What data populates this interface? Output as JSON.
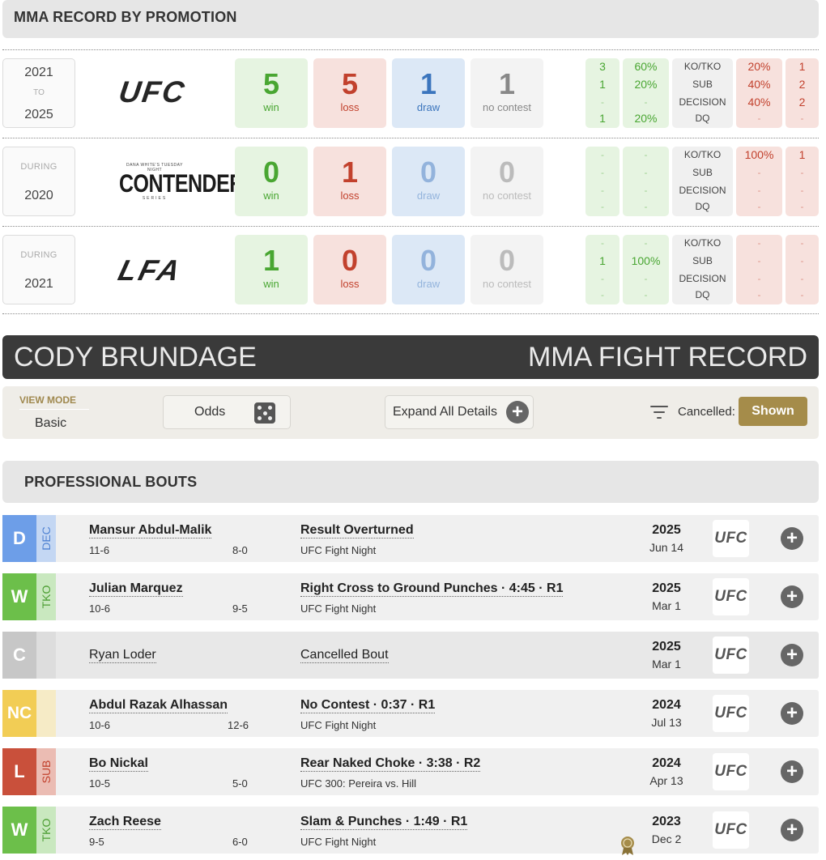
{
  "promotion_section": {
    "title": "MMA RECORD BY PROMOTION"
  },
  "promotions": [
    {
      "period": {
        "from": "2021",
        "sep": "TO",
        "to": "2025"
      },
      "logo": "UFC",
      "win": "5",
      "loss": "5",
      "draw": "1",
      "no_contest": "1",
      "labels": {
        "win": "win",
        "loss": "loss",
        "draw": "draw",
        "nc": "no contest"
      },
      "win_counts": [
        "3",
        "1",
        "-",
        "1"
      ],
      "win_pcts": [
        "60%",
        "20%",
        "-",
        "20%"
      ],
      "methods": [
        "KO/TKO",
        "SUB",
        "DECISION",
        "DQ"
      ],
      "loss_pcts": [
        "20%",
        "40%",
        "40%",
        "-"
      ],
      "loss_counts": [
        "1",
        "2",
        "2",
        "-"
      ]
    },
    {
      "period": {
        "from": "DURING",
        "to": "2020"
      },
      "logo_top": "DANA WHITE'S TUESDAY NIGHT",
      "logo": "CONTENDER",
      "logo_bottom": "SERIES",
      "win": "0",
      "loss": "1",
      "draw": "0",
      "no_contest": "0",
      "labels": {
        "win": "win",
        "loss": "loss",
        "draw": "draw",
        "nc": "no contest"
      },
      "win_counts": [
        "-",
        "-",
        "-",
        "-"
      ],
      "win_pcts": [
        "-",
        "-",
        "-",
        "-"
      ],
      "methods": [
        "KO/TKO",
        "SUB",
        "DECISION",
        "DQ"
      ],
      "loss_pcts": [
        "100%",
        "-",
        "-",
        "-"
      ],
      "loss_counts": [
        "1",
        "-",
        "-",
        "-"
      ]
    },
    {
      "period": {
        "from": "DURING",
        "to": "2021"
      },
      "logo": "LFA",
      "win": "1",
      "loss": "0",
      "draw": "0",
      "no_contest": "0",
      "labels": {
        "win": "win",
        "loss": "loss",
        "draw": "draw",
        "nc": "no contest"
      },
      "win_counts": [
        "-",
        "1",
        "-",
        "-"
      ],
      "win_pcts": [
        "-",
        "100%",
        "-",
        "-"
      ],
      "methods": [
        "KO/TKO",
        "SUB",
        "DECISION",
        "DQ"
      ],
      "loss_pcts": [
        "-",
        "-",
        "-",
        "-"
      ],
      "loss_counts": [
        "-",
        "-",
        "-",
        "-"
      ]
    }
  ],
  "banner": {
    "fighter_name": "CODY BRUNDAGE",
    "record_title": "MMA FIGHT RECORD"
  },
  "view_bar": {
    "view_mode_label": "VIEW MODE",
    "view_mode_value": "Basic",
    "odds_label": "Odds",
    "expand_label": "Expand All Details",
    "cancelled_label": "Cancelled:",
    "shown_label": "Shown"
  },
  "bouts_section": {
    "title": "PROFESSIONAL BOUTS"
  },
  "bouts": [
    {
      "result": "D",
      "method": "DEC",
      "opponent": "Mansur Abdul-Malik",
      "record_cody": "11-6",
      "record_opp": "8-0",
      "description": "Result Overturned",
      "event": "UFC Fight Night",
      "year": "2025",
      "date": "Jun 14",
      "promo": "UFC"
    },
    {
      "result": "W",
      "method": "TKO",
      "opponent": "Julian Marquez",
      "record_cody": "10-6",
      "record_opp": "9-5",
      "description": "Right Cross to Ground Punches · 4:45 · R1",
      "event": "UFC Fight Night",
      "year": "2025",
      "date": "Mar 1",
      "promo": "UFC"
    },
    {
      "result": "C",
      "method": "",
      "opponent": "Ryan Loder",
      "record_cody": "",
      "record_opp": "",
      "description": "Cancelled Bout",
      "event": "",
      "year": "2025",
      "date": "Mar 1",
      "promo": "UFC"
    },
    {
      "result": "NC",
      "method": "",
      "opponent": "Abdul Razak Alhassan",
      "record_cody": "10-6",
      "record_opp": "12-6",
      "description": "No Contest · 0:37 · R1",
      "event": "UFC Fight Night",
      "year": "2024",
      "date": "Jul 13",
      "promo": "UFC"
    },
    {
      "result": "L",
      "method": "SUB",
      "opponent": "Bo Nickal",
      "record_cody": "10-5",
      "record_opp": "5-0",
      "description": "Rear Naked Choke · 3:38 · R2",
      "event": "UFC 300: Pereira vs. Hill",
      "year": "2024",
      "date": "Apr 13",
      "promo": "UFC"
    },
    {
      "result": "W",
      "method": "TKO",
      "opponent": "Zach Reese",
      "record_cody": "9-5",
      "record_opp": "6-0",
      "description": "Slam & Punches · 1:49 · R1",
      "event": "UFC Fight Night",
      "year": "2023",
      "date": "Dec 2",
      "promo": "UFC"
    }
  ],
  "colors": {
    "win": "#6cbf4a",
    "win_light": "#c9e8bf",
    "loss": "#c9503b",
    "loss_light": "#ebbcb3",
    "draw": "#6d9ee8",
    "draw_light": "#c4d7f3",
    "nc": "#f2cd55",
    "nc_light": "#f6ebc6",
    "cancelled": "#c7c7c7",
    "cancelled_light": "#dddddd",
    "accent": "#a58c4a"
  }
}
